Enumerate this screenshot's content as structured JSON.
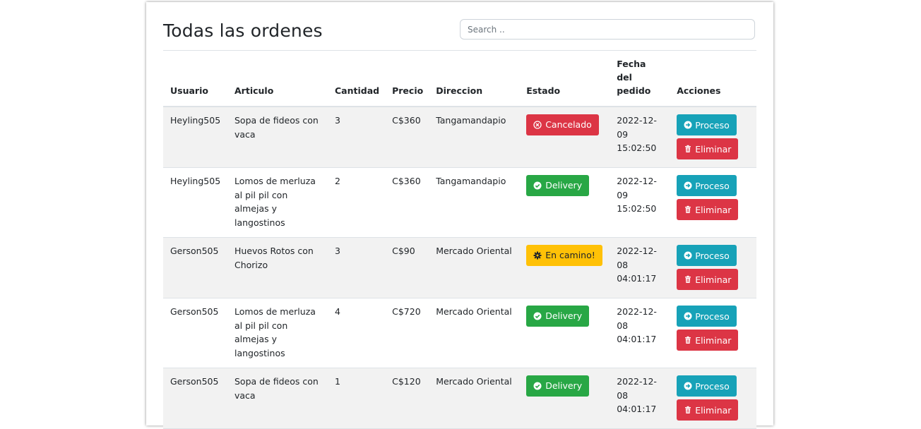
{
  "page": {
    "title": "Todas las ordenes",
    "search": {
      "placeholder": "Search ..",
      "value": ""
    }
  },
  "table": {
    "headers": {
      "usuario": "Usuario",
      "articulo": "Articulo",
      "cantidad": "Cantidad",
      "precio": "Precio",
      "direccion": "Direccion",
      "estado": "Estado",
      "fecha": "Fecha del pedido",
      "acciones": "Acciones"
    },
    "rows": [
      {
        "usuario": "Heyling505",
        "articulo": "Sopa de fideos con vaca",
        "cantidad": "3",
        "precio": "C$360",
        "direccion": "Tangamandapio",
        "estado": "Cancelado",
        "fecha": "2022-12-09 15:02:50"
      },
      {
        "usuario": "Heyling505",
        "articulo": "Lomos de merluza al pil pil con almejas y langostinos",
        "cantidad": "2",
        "precio": "C$360",
        "direccion": "Tangamandapio",
        "estado": "Delivery",
        "fecha": "2022-12-09 15:02:50"
      },
      {
        "usuario": "Gerson505",
        "articulo": "Huevos Rotos con Chorizo",
        "cantidad": "3",
        "precio": "C$90",
        "direccion": "Mercado Oriental",
        "estado": "En camino!",
        "fecha": "2022-12-08 04:01:17"
      },
      {
        "usuario": "Gerson505",
        "articulo": "Lomos de merluza al pil pil con almejas y langostinos",
        "cantidad": "4",
        "precio": "C$720",
        "direccion": "Mercado Oriental",
        "estado": "Delivery",
        "fecha": "2022-12-08 04:01:17"
      },
      {
        "usuario": "Gerson505",
        "articulo": "Sopa de fideos con vaca",
        "cantidad": "1",
        "precio": "C$120",
        "direccion": "Mercado Oriental",
        "estado": "Delivery",
        "fecha": "2022-12-08 04:01:17"
      }
    ],
    "actions": {
      "proceso": "Proceso",
      "eliminar": "Eliminar"
    }
  },
  "icons": {
    "cancelado": "x-circle-icon",
    "delivery": "check-circle-icon",
    "en_camino": "gear-icon",
    "proceso": "arrow-circle-right-icon",
    "eliminar": "trash-icon"
  },
  "colors": {
    "danger": "#dc3545",
    "success": "#28a745",
    "warning": "#ffc107",
    "info": "#17a2b8",
    "stripe": "#f2f2f2"
  }
}
